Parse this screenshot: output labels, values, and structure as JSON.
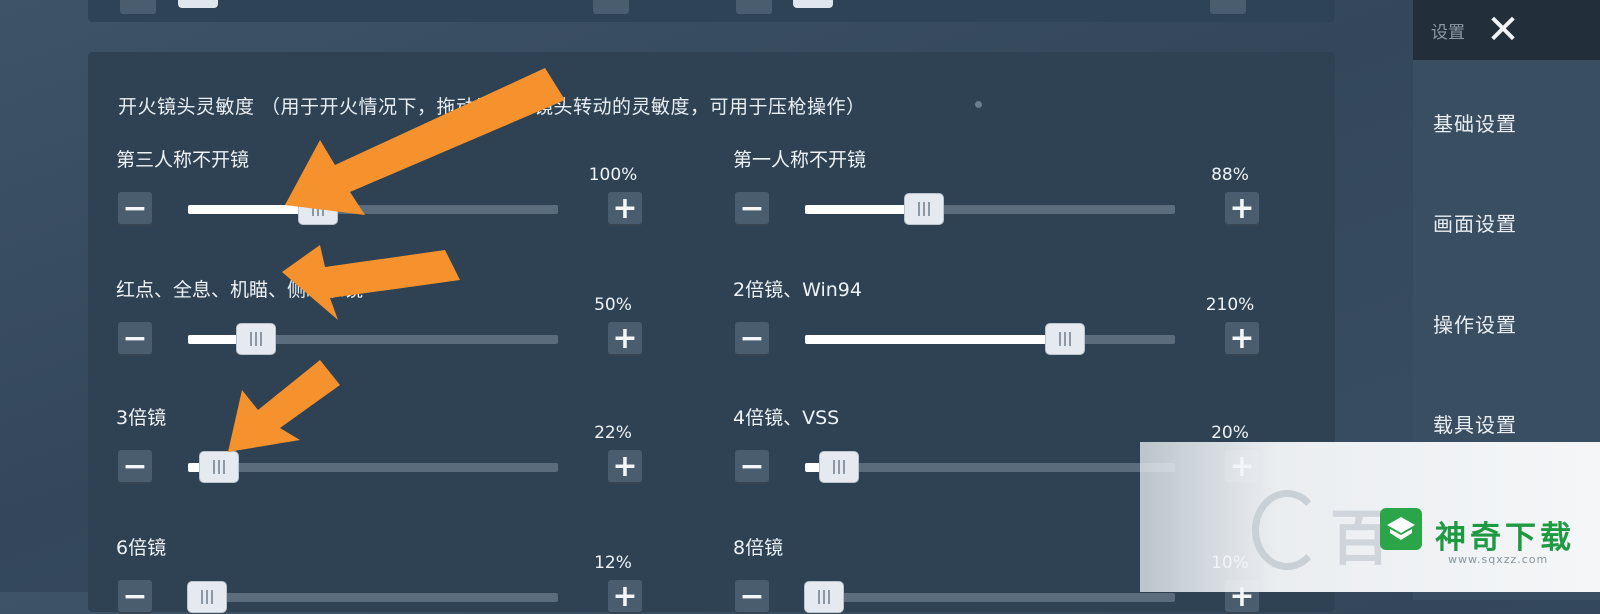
{
  "section": {
    "title": "开火镜头灵敏度 （用于开火情况下，拖动屏幕时镜头转动的灵敏度，可用于压枪操作）"
  },
  "sliders": [
    {
      "label": "第三人称不开镜",
      "percent": "100%",
      "value": 100
    },
    {
      "label": "第一人称不开镜",
      "percent": "88%",
      "value": 88
    },
    {
      "label": "红点、全息、机瞄、侧瞄准镜",
      "percent": "50%",
      "value": 50
    },
    {
      "label": "2倍镜、Win94",
      "percent": "210%",
      "value": 210
    },
    {
      "label": "3倍镜",
      "percent": "22%",
      "value": 22
    },
    {
      "label": "4倍镜、VSS",
      "percent": "20%",
      "value": 20
    },
    {
      "label": "6倍镜",
      "percent": "12%",
      "value": 12
    },
    {
      "label": "8倍镜",
      "percent": "10%",
      "value": 10
    }
  ],
  "slider_max": 300,
  "buttons": {
    "minus": "−",
    "plus": "+"
  },
  "sidebar": {
    "header_label": "设置",
    "close_glyph": "✕",
    "items": [
      {
        "label": "基础设置"
      },
      {
        "label": "画面设置"
      },
      {
        "label": "操作设置"
      },
      {
        "label": "载具设置"
      }
    ]
  },
  "watermark": {
    "title": "神奇下载",
    "url": "www.sqxzz.com",
    "faded_text": "百"
  },
  "colors": {
    "arrow": "#f5922e",
    "watermark_green": "#1f9a43"
  }
}
